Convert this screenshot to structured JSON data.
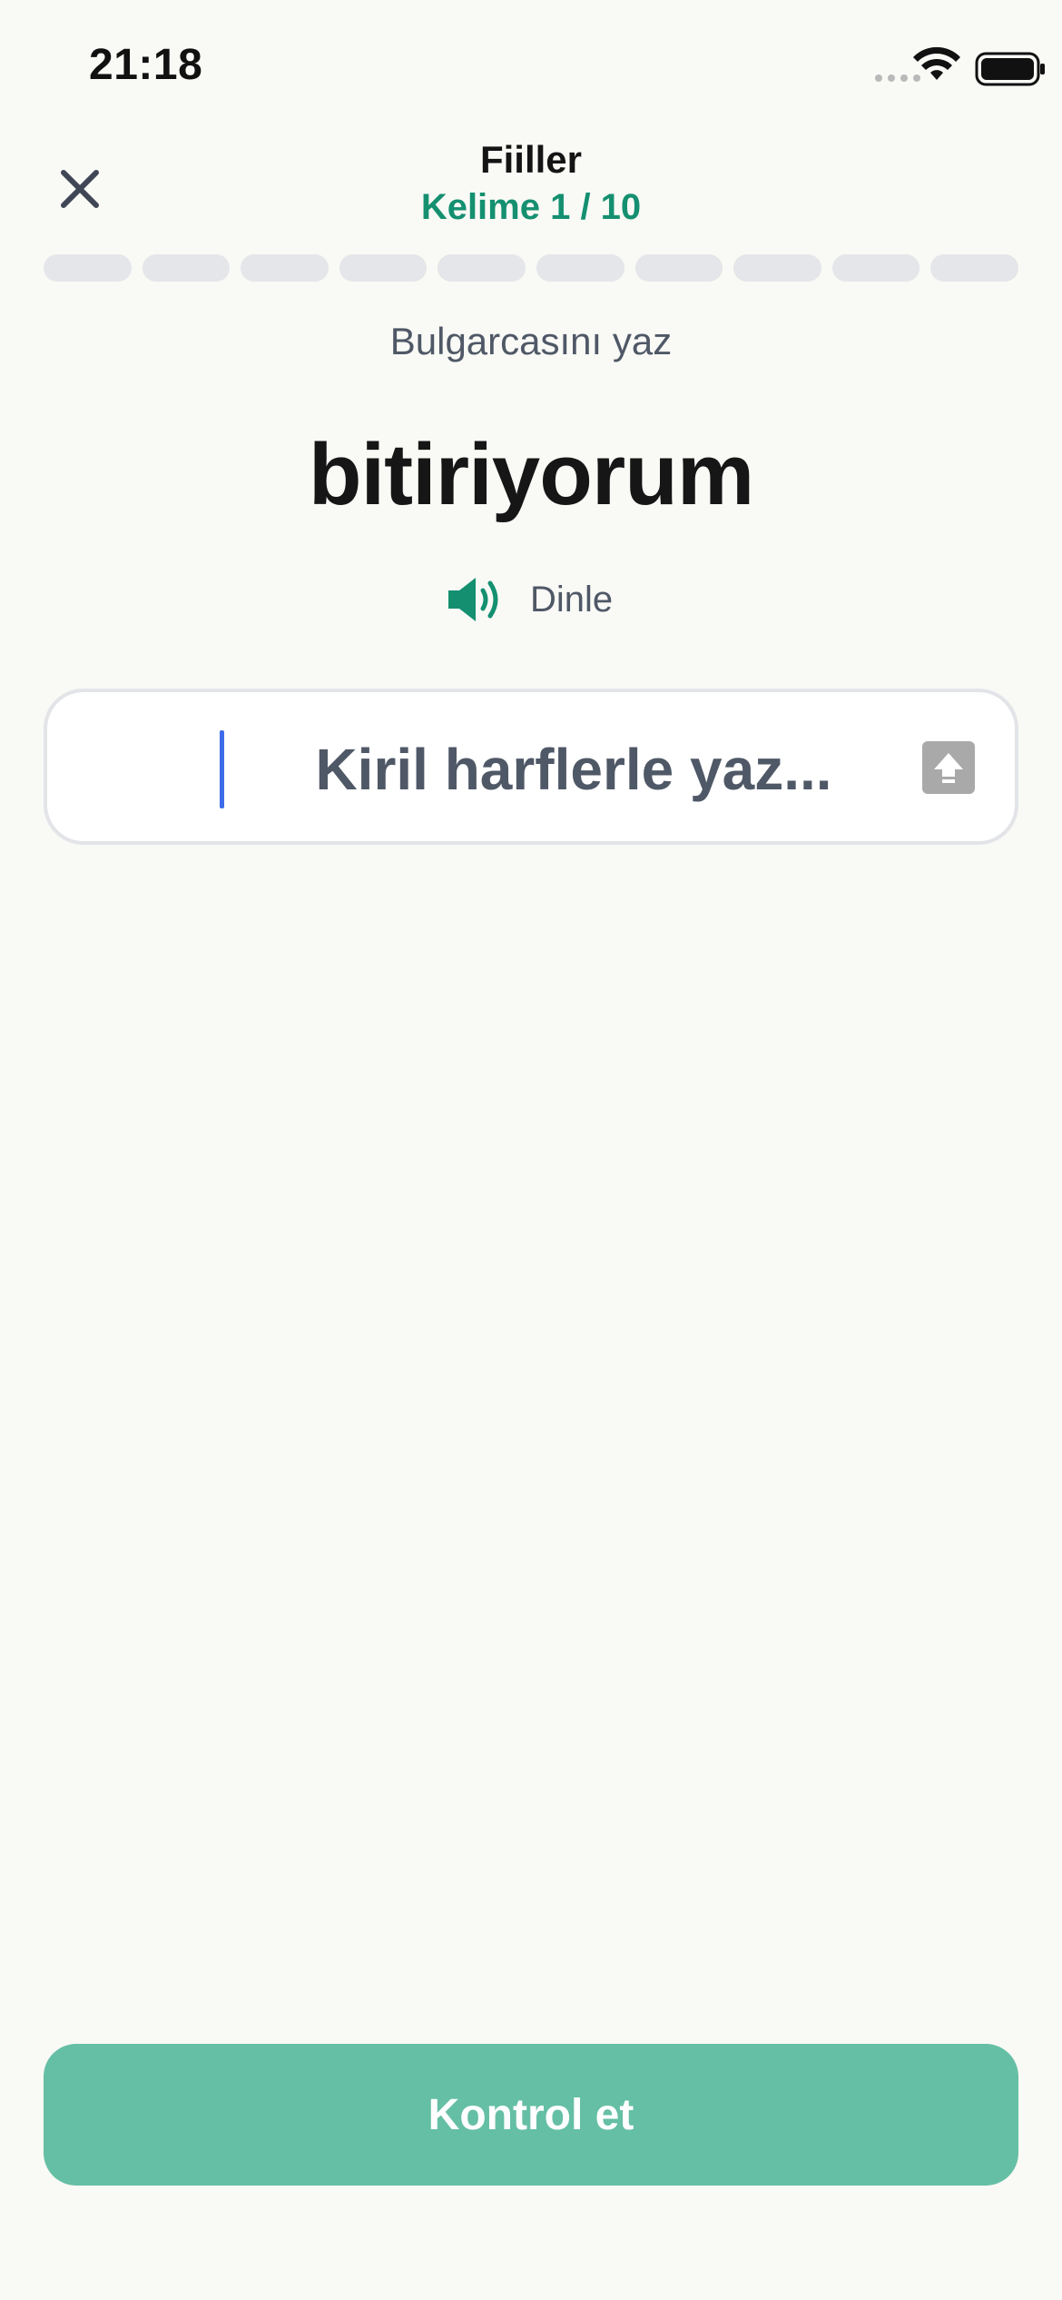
{
  "status_bar": {
    "time": "21:18"
  },
  "header": {
    "title": "Fiiller",
    "subtitle": "Kelime 1 / 10",
    "progress": {
      "current": 0,
      "total": 10
    }
  },
  "exercise": {
    "instruction": "Bulgarcasını yaz",
    "word": "bitiriyorum",
    "listen_label": "Dinle"
  },
  "answer": {
    "value": "",
    "placeholder": "Kiril harflerle yaz..."
  },
  "actions": {
    "check_label": "Kontrol et"
  },
  "colors": {
    "accent": "#149070",
    "button": "#65bfa4",
    "background": "#f9f9f6",
    "caret": "#3e6bea"
  },
  "icons": {
    "close": "close-icon",
    "speaker": "speaker-icon",
    "shift": "shift-icon"
  }
}
